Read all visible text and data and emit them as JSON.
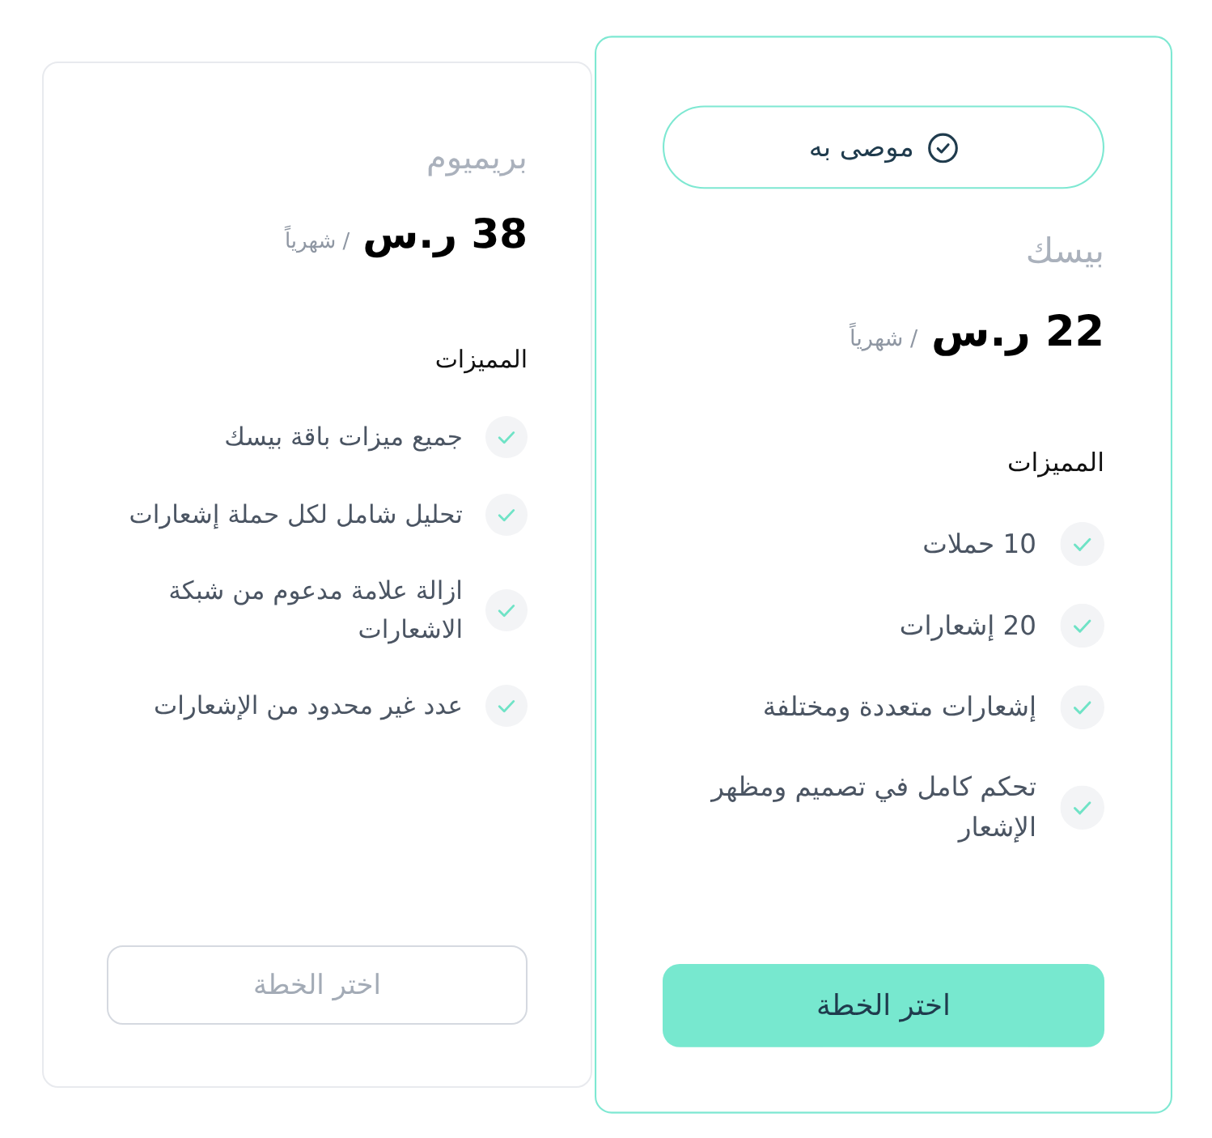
{
  "plans": [
    {
      "name": "بيسك",
      "recommended": true,
      "badge": "موصى به",
      "price": "22 ر.س",
      "period": "/ شهرياً",
      "features_title": "المميزات",
      "features": [
        "10 حملات",
        "20 إشعارات",
        "إشعارات متعددة ومختلفة",
        "تحكم كامل في تصميم ومظهر الإشعار"
      ],
      "button": "اختر الخطة"
    },
    {
      "name": "بريميوم",
      "recommended": false,
      "price": "38 ر.س",
      "period": "/ شهرياً",
      "features_title": "المميزات",
      "features": [
        "جميع ميزات باقة بيسك",
        "تحليل شامل لكل حملة إشعارات",
        "ازالة علامة مدعوم من شبكة الاشعارات",
        "عدد غير محدود من الإشعارات"
      ],
      "button": "اختر الخطة"
    }
  ]
}
